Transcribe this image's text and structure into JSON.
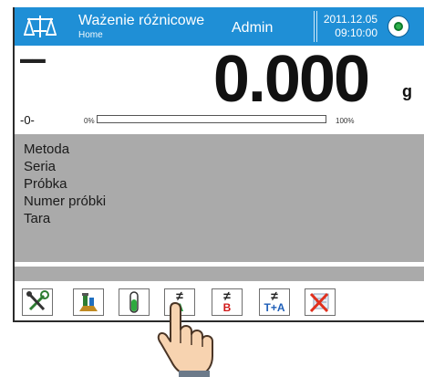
{
  "header": {
    "title": "Ważenie różnicowe",
    "subtitle": "Home",
    "user": "Admin",
    "date": "2011.12.05",
    "time": "09:10:00",
    "bg_color": "#1f8fd6",
    "status_icon": "status-ok-icon"
  },
  "weighing": {
    "stability_mark": "▬ ▬",
    "value": "0.000",
    "unit": "g",
    "zero_indicator": "-0-",
    "bar_min_label": "0%",
    "bar_max_label": "100%",
    "bar_level_percent": 0
  },
  "info": {
    "lines": [
      "Metoda",
      "Seria",
      "Próbka",
      "Numer próbki",
      "Tara"
    ],
    "bg_color": "#aaaaaa"
  },
  "toolbar": {
    "buttons": [
      {
        "icon": "tools-icon"
      },
      {
        "icon": "loader-icon"
      },
      {
        "icon": "test-tube-icon"
      },
      {
        "icon": "difference-a-icon",
        "glyph": "≠",
        "label": "A",
        "label_color": "#1a9a3a"
      },
      {
        "icon": "difference-b-icon",
        "glyph": "≠",
        "label": "B",
        "label_color": "#d01818"
      },
      {
        "icon": "difference-ta-icon",
        "glyph": "≠",
        "label": "T+A",
        "label_color": "#1f5fb8"
      },
      {
        "icon": "delete-data-icon"
      }
    ]
  }
}
